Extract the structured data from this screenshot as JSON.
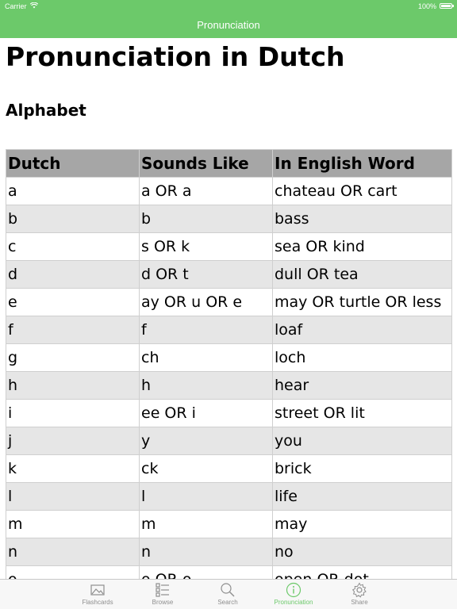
{
  "status_bar": {
    "carrier": "Carrier",
    "battery": "100%"
  },
  "nav": {
    "title": "Pronunciation"
  },
  "page": {
    "title": "Pronunciation in Dutch",
    "section": "Alphabet"
  },
  "table": {
    "headers": [
      "Dutch",
      "Sounds Like",
      "In English Word"
    ],
    "rows": [
      [
        "a",
        "a OR a",
        "chateau OR cart"
      ],
      [
        "b",
        "b",
        "bass"
      ],
      [
        "c",
        "s OR k",
        "sea OR kind"
      ],
      [
        "d",
        "d OR t",
        "dull OR tea"
      ],
      [
        "e",
        "ay OR u OR e",
        "may OR turtle OR less"
      ],
      [
        "f",
        "f",
        "loaf"
      ],
      [
        "g",
        "ch",
        "loch"
      ],
      [
        "h",
        "h",
        "hear"
      ],
      [
        "i",
        "ee OR i",
        "street OR lit"
      ],
      [
        "j",
        "y",
        "you"
      ],
      [
        "k",
        "ck",
        "brick"
      ],
      [
        "l",
        "l",
        "life"
      ],
      [
        "m",
        "m",
        "may"
      ],
      [
        "n",
        "n",
        "no"
      ],
      [
        "o",
        "o OR o",
        "open OR dot"
      ]
    ]
  },
  "tabs": [
    {
      "label": "Flashcards",
      "icon": "flashcards-icon"
    },
    {
      "label": "Browse",
      "icon": "browse-list-icon"
    },
    {
      "label": "Search",
      "icon": "search-icon"
    },
    {
      "label": "Pronunciation",
      "icon": "info-icon",
      "active": true
    },
    {
      "label": "Share",
      "icon": "gear-icon"
    }
  ],
  "colors": {
    "accent": "#6cc96a",
    "header_row": "#a6a6a6",
    "stripe": "#e6e6e6",
    "tab_inactive": "#8e8e8e"
  }
}
